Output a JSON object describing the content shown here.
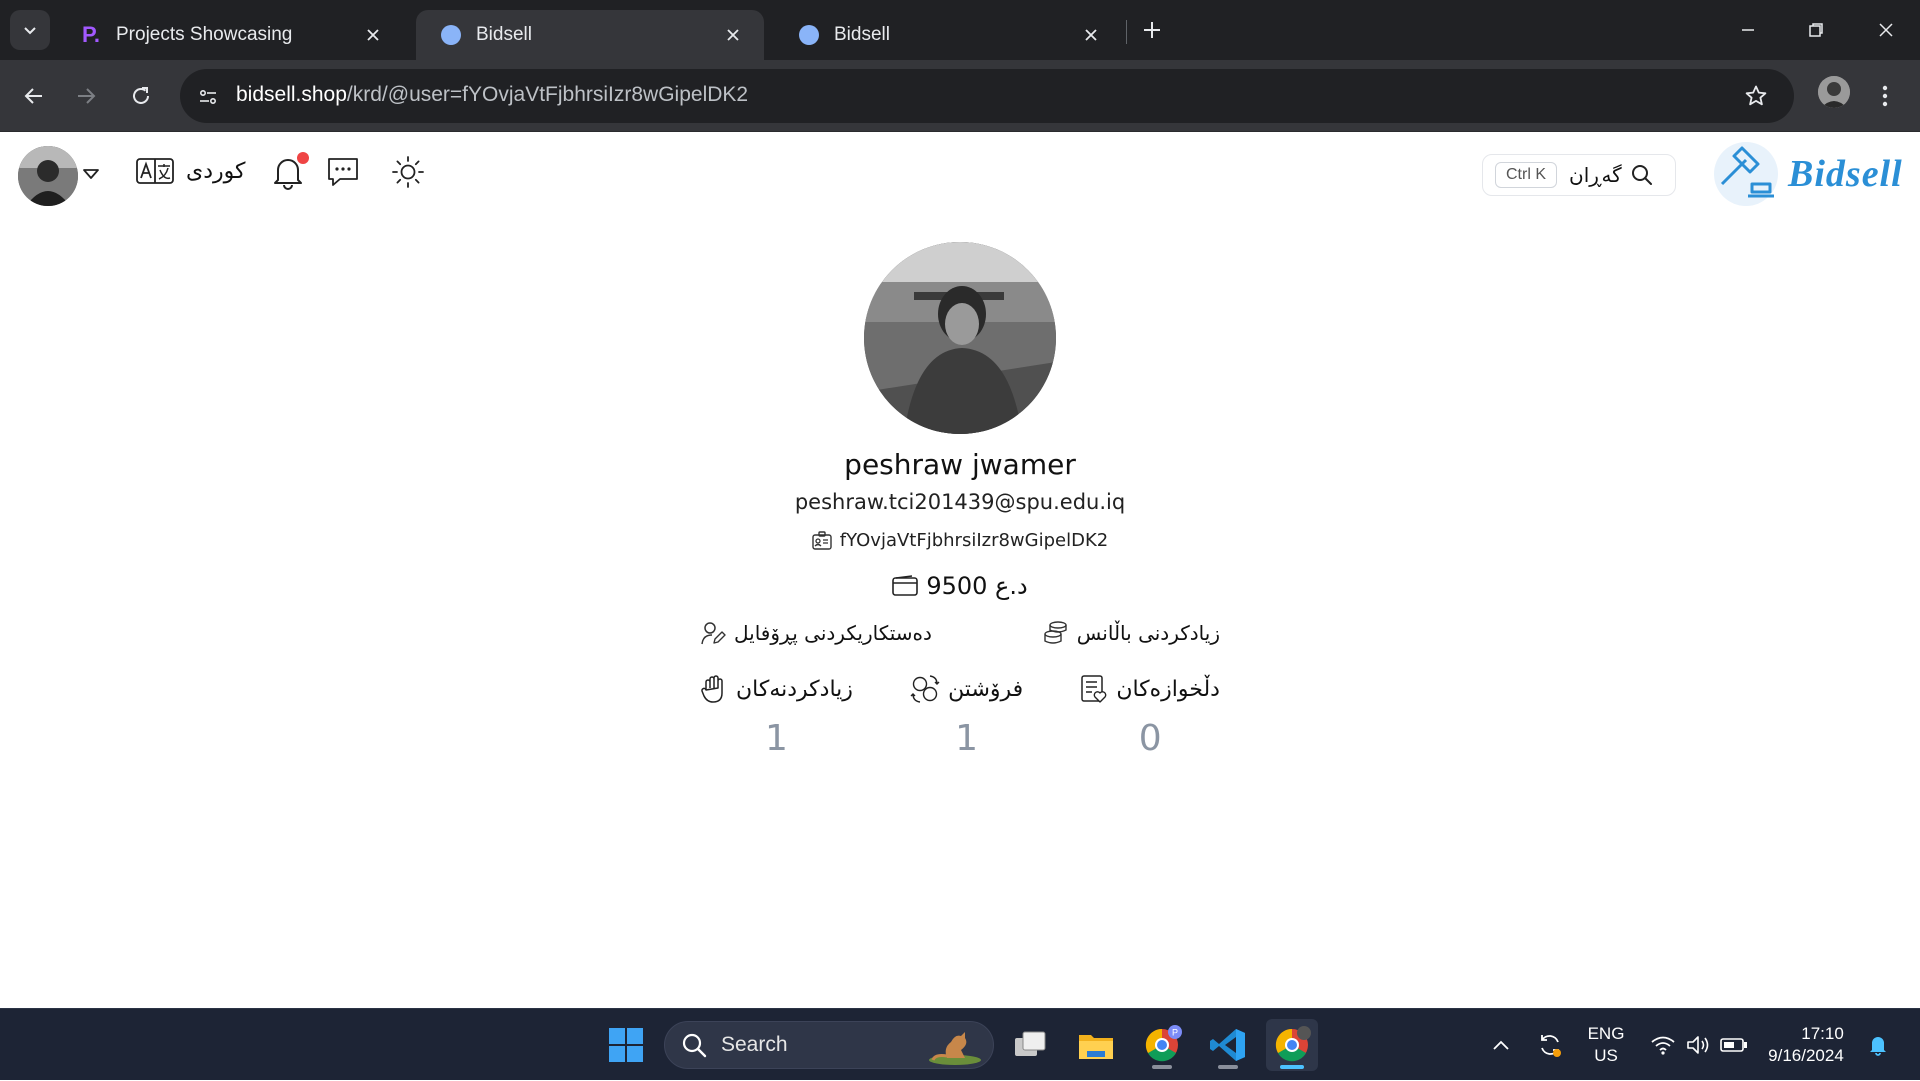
{
  "browser": {
    "tabs": [
      {
        "title": "Projects Showcasing",
        "favicon": "p-logo-icon",
        "active": false
      },
      {
        "title": "Bidsell",
        "favicon": "bidsell-icon",
        "active": true
      },
      {
        "title": "Bidsell",
        "favicon": "bidsell-icon",
        "active": false
      }
    ],
    "url": {
      "host": "bidsell.shop",
      "path": "/krd/@user=fYOvjaVtFjbhrsiIzr8wGipelDK2"
    }
  },
  "header": {
    "language_label": "کوردی",
    "search_label": "گەڕان",
    "search_shortcut": "Ctrl K",
    "logo_text": "Bidsell",
    "notification_dot_color": "#ef4444"
  },
  "profile": {
    "name": "peshraw jwamer",
    "email": "peshraw.tci201439@spu.edu.iq",
    "user_id": "fYOvjaVtFjbhrsiIzr8wGipelDK2",
    "balance": "9500 د.ع",
    "actions": {
      "edit_profile": "دەستکاریکردنی پڕۆفایل",
      "add_balance": "زیادکردنی باڵانس"
    },
    "stats": [
      {
        "label": "زیادکردنەکان",
        "value": "1",
        "icon": "hand-icon"
      },
      {
        "label": "فرۆشتن",
        "value": "1",
        "icon": "exchange-coins-icon"
      },
      {
        "label": "دڵخوازەکان",
        "value": "0",
        "icon": "favorites-list-icon"
      }
    ]
  },
  "taskbar": {
    "search_placeholder": "Search",
    "language": {
      "line1": "ENG",
      "line2": "US"
    },
    "time": "17:10",
    "date": "9/16/2024",
    "accent_color": "#4cc2ff"
  }
}
